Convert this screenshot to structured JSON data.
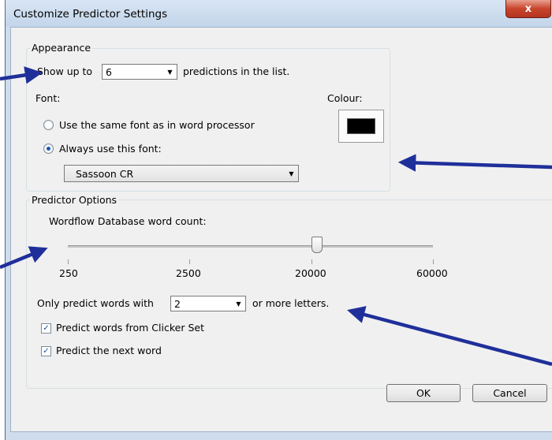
{
  "window": {
    "title": "Customize Predictor Settings",
    "close_glyph": "x"
  },
  "appearance": {
    "group_label": "Appearance",
    "show_up_to_label": "Show up to",
    "show_up_to_value": "6",
    "predictions_suffix": "predictions in the list.",
    "font_label": "Font:",
    "colour_label": "Colour:",
    "colour_value": "#000000",
    "radio_same_font": "Use the same font as in word processor",
    "radio_always_font": "Always use this font:",
    "selected_radio": "always",
    "font_value": "Sassoon CR"
  },
  "predictor": {
    "group_label": "Predictor Options",
    "slider_label": "Wordflow Database word count:",
    "slider_ticks": [
      "250",
      "2500",
      "20000",
      "60000"
    ],
    "slider_value": "20000",
    "only_predict_label": "Only predict words with",
    "min_letters_value": "2",
    "min_letters_suffix": "or more letters.",
    "check_clicker_set": "Predict words from Clicker Set",
    "check_next_word": "Predict the next word",
    "check_clicker_set_checked": true,
    "check_next_word_checked": true
  },
  "buttons": {
    "ok": "OK",
    "cancel": "Cancel"
  },
  "annotation_color": "#1f2f9a"
}
